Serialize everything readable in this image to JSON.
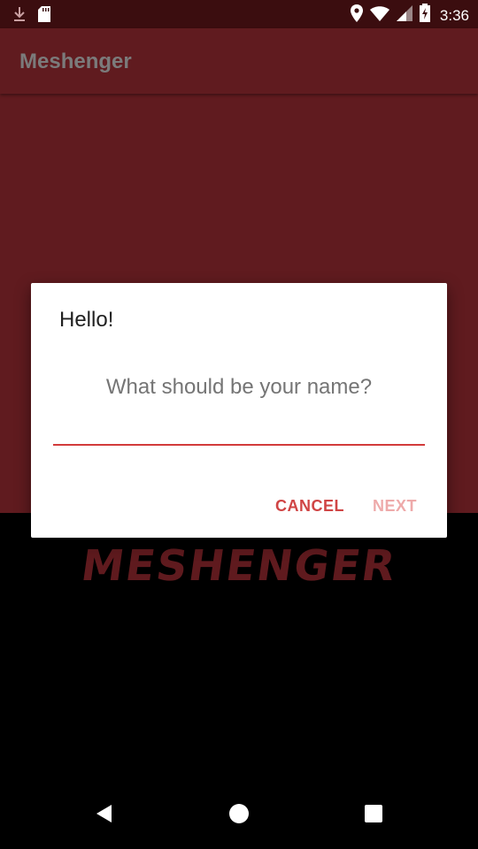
{
  "status_bar": {
    "time": "3:36",
    "icons": [
      "download-icon",
      "sd-card-icon",
      "location-icon",
      "wifi-icon",
      "signal-icon",
      "battery-icon"
    ]
  },
  "app_bar": {
    "title": "Meshenger"
  },
  "dialog": {
    "title": "Hello!",
    "message": "What should be your name?",
    "input_value": "",
    "cancel_label": "CANCEL",
    "next_label": "NEXT"
  },
  "logo": {
    "text": "MESHENGER"
  },
  "nav_bar": {
    "icons": [
      "back-icon",
      "home-icon",
      "recents-icon"
    ]
  },
  "colors": {
    "status_bar": "#3b0d0f",
    "primary": "#601b1f",
    "accent": "#d23b3b",
    "next_disabled": "#eeaaaa"
  }
}
